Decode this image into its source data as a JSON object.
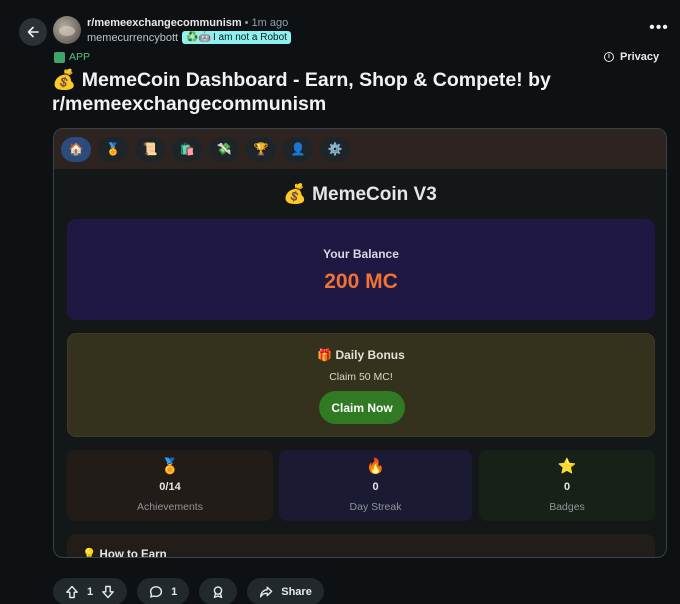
{
  "header": {
    "subreddit": "r/memeexchangecommunism",
    "separator": "•",
    "time": "1m ago",
    "username": "memecurrencybott",
    "flair_emoji": "♻️🤖",
    "flair_text": "I am not a Robot",
    "more_label": "•••"
  },
  "app_tag": "APP",
  "privacy_label": "Privacy",
  "post_title": "💰 MemeCoin Dashboard - Earn, Shop & Compete! by r/memeexchangecommunism",
  "app": {
    "nav": [
      {
        "icon": "🏠",
        "name": "home"
      },
      {
        "icon": "🏅",
        "name": "achievements"
      },
      {
        "icon": "📜",
        "name": "history"
      },
      {
        "icon": "🛍️",
        "name": "shop"
      },
      {
        "icon": "💸",
        "name": "earn"
      },
      {
        "icon": "🏆",
        "name": "leaderboard"
      },
      {
        "icon": "👤",
        "name": "profile"
      },
      {
        "icon": "⚙️",
        "name": "settings"
      }
    ],
    "title": "💰 MemeCoin V3",
    "balance_label": "Your Balance",
    "balance_value": "200 MC",
    "bonus_title": "🎁 Daily Bonus",
    "bonus_sub": "Claim 50 MC!",
    "claim_label": "Claim Now",
    "stats": [
      {
        "icon": "🏅",
        "value": "0/14",
        "label": "Achievements"
      },
      {
        "icon": "🔥",
        "value": "0",
        "label": "Day Streak"
      },
      {
        "icon": "⭐",
        "value": "0",
        "label": "Badges"
      }
    ],
    "earn_title": "💡 How to Earn"
  },
  "actions": {
    "votes": "1",
    "comments": "1",
    "share_label": "Share"
  },
  "colors": {
    "accent_balance": "#f07235",
    "claim_button": "#2f7a22",
    "app_tag": "#55c37b",
    "flair_bg": "#8ff0f0"
  }
}
